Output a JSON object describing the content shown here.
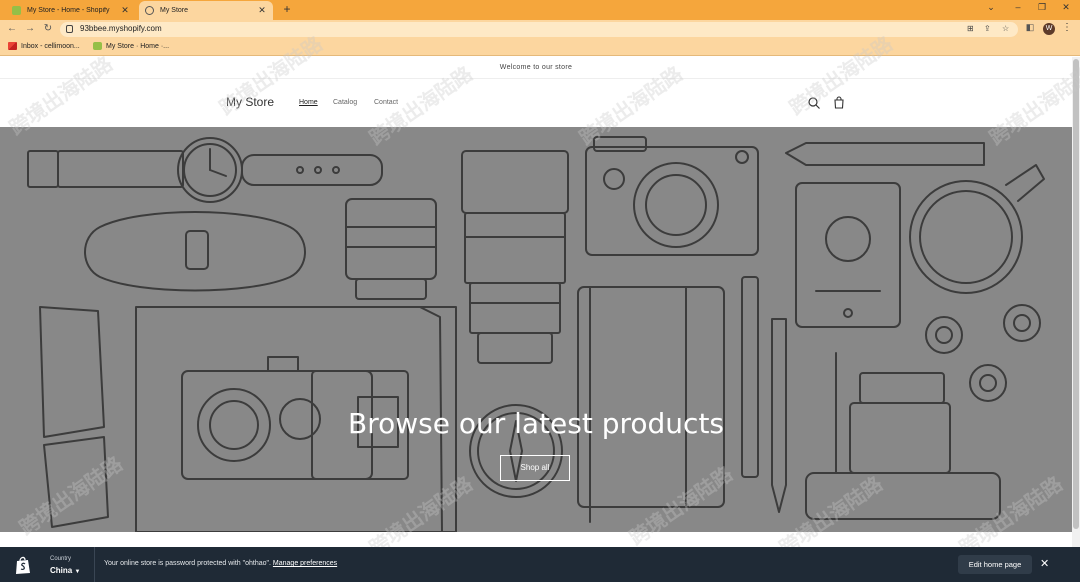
{
  "browser": {
    "tabs": [
      {
        "title": "My Store - Home - Shopify",
        "active": false
      },
      {
        "title": "My Store",
        "active": true
      }
    ],
    "url": "93bbee.myshopify.com",
    "profile_initial": "W",
    "bookmarks": [
      {
        "label": "Inbox - cellimoon..."
      },
      {
        "label": "My Store · Home ·..."
      }
    ],
    "accent": "#f5a63c"
  },
  "store": {
    "announcement": "Welcome to our store",
    "logo": "My Store",
    "nav": [
      "Home",
      "Catalog",
      "Contact"
    ],
    "hero": {
      "title": "Browse our latest products",
      "button": "Shop all"
    }
  },
  "admin_bar": {
    "country_label": "Country",
    "country_value": "China",
    "message": "Your online store is password protected with \"ohthao\". ",
    "link": "Manage preferences",
    "edit_button": "Edit home page"
  },
  "watermark_text": "跨境出海陆路"
}
